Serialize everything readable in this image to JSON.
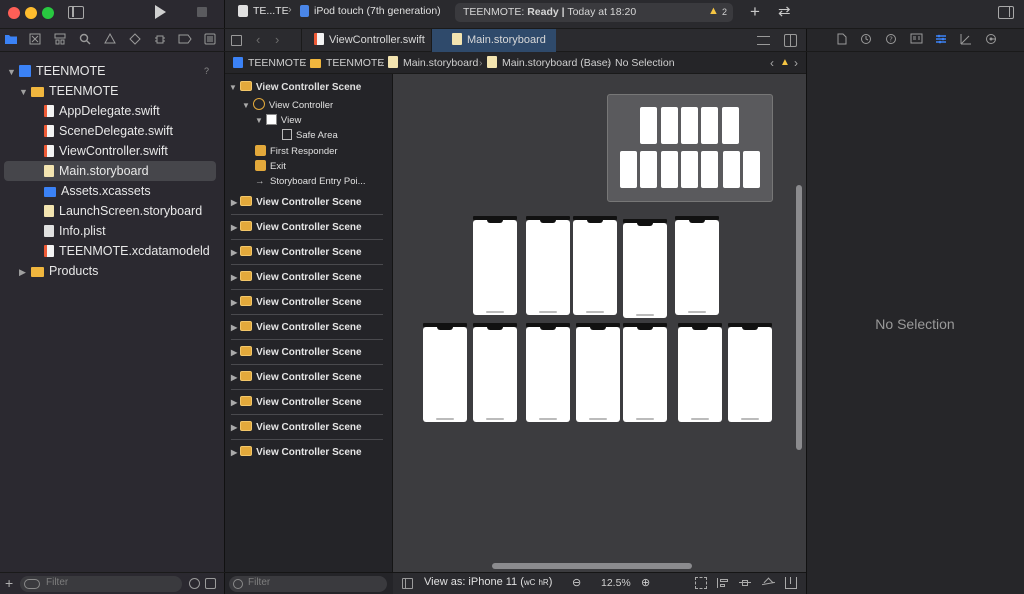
{
  "window": {
    "traffic_colors": [
      "#ff5f57",
      "#febc2e",
      "#28c840"
    ]
  },
  "toolbar": {
    "scheme": "TE...TE",
    "destination": "iPod touch (7th generation)",
    "status_project": "TEENMOTE:",
    "status_state": "Ready",
    "status_separator": "|",
    "status_time": "Today at 18:20",
    "warning_count": "2",
    "add_label": "+",
    "swap_label": "⇄"
  },
  "navigator": {
    "tree": [
      {
        "label": "TEENMOTE",
        "kind": "project",
        "badge": "?"
      },
      {
        "label": "TEENMOTE",
        "kind": "folder"
      },
      {
        "label": "AppDelegate.swift",
        "kind": "swift"
      },
      {
        "label": "SceneDelegate.swift",
        "kind": "swift"
      },
      {
        "label": "ViewController.swift",
        "kind": "swift"
      },
      {
        "label": "Main.storyboard",
        "kind": "storyboard"
      },
      {
        "label": "Assets.xcassets",
        "kind": "assets"
      },
      {
        "label": "LaunchScreen.storyboard",
        "kind": "storyboard"
      },
      {
        "label": "Info.plist",
        "kind": "plist"
      },
      {
        "label": "TEENMOTE.xcdatamodeld",
        "kind": "datamodel"
      },
      {
        "label": "Products",
        "kind": "folder"
      }
    ],
    "filter_placeholder": "Filter"
  },
  "editor": {
    "tabs": [
      {
        "label": "ViewController.swift"
      },
      {
        "label": "Main.storyboard"
      }
    ],
    "jumpbar": [
      "TEENMOTE",
      "TEENMOTE",
      "Main.storyboard",
      "Main.storyboard (Base)",
      "No Selection"
    ]
  },
  "outline": {
    "first_scene": "View Controller Scene",
    "children": [
      "View Controller",
      "View",
      "Safe Area",
      "First Responder",
      "Exit",
      "Storyboard Entry Poi..."
    ],
    "scenes": [
      "View Controller Scene",
      "View Controller Scene",
      "View Controller Scene",
      "View Controller Scene",
      "View Controller Scene",
      "View Controller Scene",
      "View Controller Scene",
      "View Controller Scene",
      "View Controller Scene",
      "View Controller Scene",
      "View Controller Scene"
    ],
    "filter_placeholder": "Filter"
  },
  "canvas_bar": {
    "view_as_prefix": "View as: iPhone 11 (",
    "size_class_w": "wC",
    "size_class_h": "hR",
    "view_as_suffix": ")",
    "zoom": "12.5%"
  },
  "inspector": {
    "empty_text": "No Selection"
  },
  "colors": {
    "accent": "#3b82f6",
    "selection": "#46464b",
    "warning": "#f5c542",
    "outline_icon": "#e3a93b",
    "active_tab": "#2f4a6b"
  }
}
